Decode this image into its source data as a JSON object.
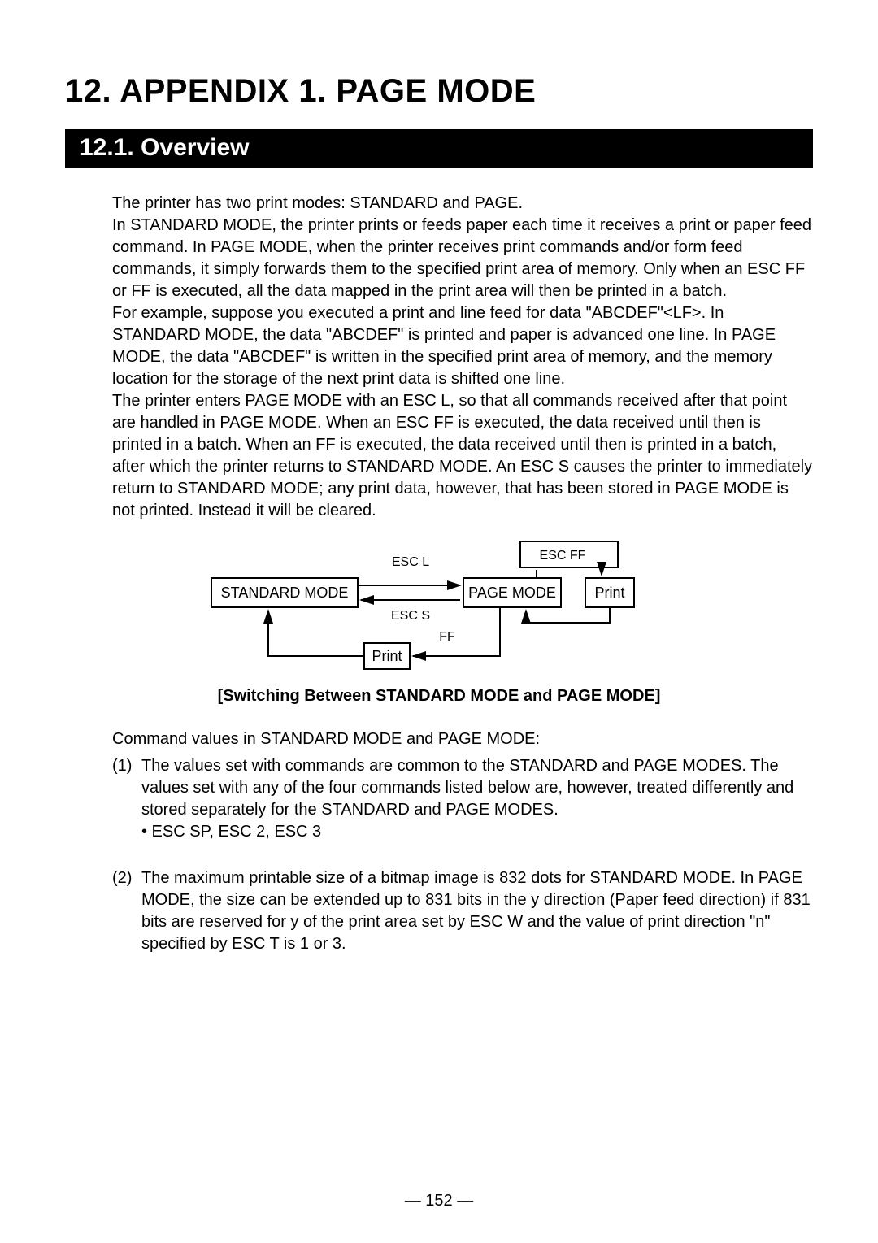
{
  "title": "12. APPENDIX 1. PAGE MODE",
  "section": "12.1. Overview",
  "para1": "The printer has two print modes: STANDARD and PAGE.",
  "para2": "In STANDARD MODE, the printer prints or feeds paper each time it receives a print or paper feed command. In PAGE MODE, when the printer receives print commands and/or form feed commands, it simply forwards them to the specified print area of memory. Only when an ESC FF or FF is executed, all the data mapped in the print area will then be printed in a batch.",
  "para3": "For example, suppose you executed a print and line feed for data \"ABCDEF\"<LF>. In STANDARD MODE, the data \"ABCDEF\" is printed and paper is advanced one line. In PAGE MODE, the data \"ABCDEF\" is written in the specified print area of memory, and the memory location for the storage of the next print data is shifted one line.",
  "para4": "The printer enters PAGE MODE with an ESC L, so that all commands received after that point are handled in PAGE MODE. When an ESC FF is executed, the data received until then is printed in a batch. When an FF is executed, the data received until then is printed in a batch, after which the printer returns to STANDARD MODE. An ESC S causes the printer to immediately return to STANDARD MODE; any print data, however, that has been stored in PAGE MODE is not printed. Instead it will be cleared.",
  "diagram": {
    "standard_mode": "STANDARD MODE",
    "page_mode": "PAGE MODE",
    "print": "Print",
    "esc_l": "ESC L",
    "esc_s": "ESC S",
    "esc_ff": "ESC FF",
    "ff": "FF",
    "caption": "[Switching Between STANDARD MODE and PAGE MODE]"
  },
  "cmdvalues_heading": "Command values in STANDARD MODE and PAGE MODE:",
  "item1_num": "(1)",
  "item1_body": "The values set with commands are common to the STANDARD and PAGE MODES. The values set with any of the four commands listed below are, however, treated differently and stored separately for the STANDARD and PAGE MODES.",
  "item1_bullet": "• ESC SP, ESC 2, ESC 3",
  "item2_num": "(2)",
  "item2_body": "The maximum printable size of a bitmap image is 832 dots for STANDARD MODE. In PAGE MODE, the size can be extended up to 831 bits in the y direction (Paper feed direction) if 831 bits are reserved for y of the print area set by ESC W and the value of print direction \"n\" specified by ESC T is 1 or 3.",
  "page_number": "— 152 —"
}
